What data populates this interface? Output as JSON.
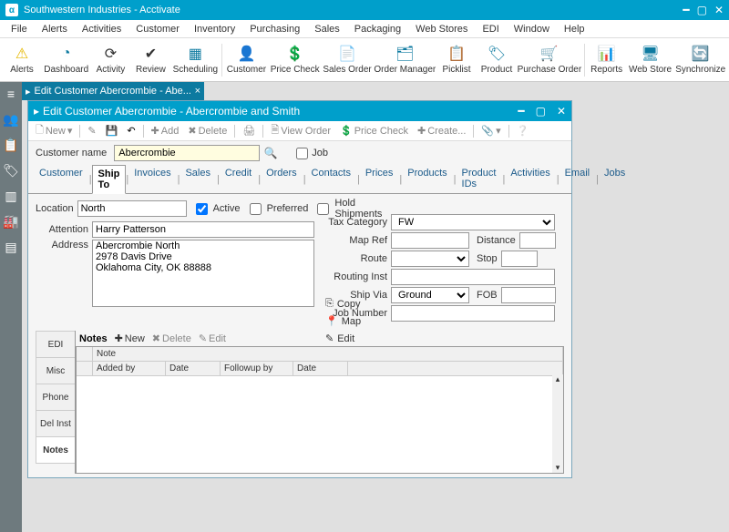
{
  "app": {
    "title": "Southwestern Industries - Acctivate"
  },
  "menu": [
    "File",
    "Alerts",
    "Activities",
    "Customer",
    "Inventory",
    "Purchasing",
    "Sales",
    "Packaging",
    "Web Stores",
    "EDI",
    "Window",
    "Help"
  ],
  "toolbar": [
    {
      "label": "Alerts",
      "icon": "⚠",
      "color": "#e6b800"
    },
    {
      "label": "Dashboard",
      "icon": "◔",
      "color": "#0d7aa0"
    },
    {
      "label": "Activity",
      "icon": "⟳",
      "color": "#333"
    },
    {
      "label": "Review",
      "icon": "✔",
      "color": "#333"
    },
    {
      "label": "Scheduling",
      "icon": "▦",
      "color": "#0d7aa0"
    },
    {
      "label": "Customer",
      "icon": "👤",
      "color": "#0d7aa0"
    },
    {
      "label": "Price Check",
      "icon": "💲",
      "color": "#2a9d3a"
    },
    {
      "label": "Sales Order",
      "icon": "📄",
      "color": "#0d7aa0"
    },
    {
      "label": "Order Manager",
      "icon": "🗂",
      "color": "#0d7aa0"
    },
    {
      "label": "Picklist",
      "icon": "📋",
      "color": "#0d7aa0"
    },
    {
      "label": "Product",
      "icon": "🏷",
      "color": "#0d7aa0"
    },
    {
      "label": "Purchase Order",
      "icon": "🛒",
      "color": "#0d7aa0"
    },
    {
      "label": "Reports",
      "icon": "📊",
      "color": "#0d7aa0"
    },
    {
      "label": "Web Store",
      "icon": "🖥",
      "color": "#0d7aa0"
    },
    {
      "label": "Synchronize",
      "icon": "🔄",
      "color": "#0d7aa0"
    }
  ],
  "toolbar_separators_after": [
    4,
    11
  ],
  "mdi_tab": {
    "title": "Edit Customer Abercrombie - Abe..."
  },
  "child": {
    "title": "Edit Customer Abercrombie - Abercrombie and Smith",
    "toolbar": {
      "new": "New",
      "add": "Add",
      "delete": "Delete",
      "view_order": "View Order",
      "price_check": "Price Check",
      "create": "Create..."
    },
    "customer_name_label": "Customer name",
    "customer_name": "Abercrombie",
    "job_label": "Job",
    "tabs": [
      "Customer",
      "Ship To",
      "Invoices",
      "Sales",
      "Credit",
      "Orders",
      "Contacts",
      "Prices",
      "Products",
      "Product IDs",
      "Activities",
      "Email",
      "Jobs"
    ],
    "active_tab_index": 1,
    "left": {
      "location_label": "Location",
      "location": "North",
      "active_label": "Active",
      "preferred_label": "Preferred",
      "hold_label": "Hold Shipments",
      "attention_label": "Attention",
      "attention": "Harry Patterson",
      "address_label": "Address",
      "address": "Abercrombie North\n2978 Davis Drive\nOklahoma City, OK 88888"
    },
    "actions": {
      "copy": "Copy",
      "map": "Map",
      "edit": "Edit"
    },
    "right": {
      "tax_cat_label": "Tax Category",
      "tax_cat": "FW",
      "map_ref_label": "Map Ref",
      "map_ref": "",
      "distance_label": "Distance",
      "distance": "",
      "route_label": "Route",
      "route": "",
      "stop_label": "Stop",
      "stop": "",
      "routing_label": "Routing Inst",
      "routing": "",
      "ship_via_label": "Ship Via",
      "ship_via": "Ground",
      "fob_label": "FOB",
      "fob": "",
      "job_num_label": "Job Number",
      "job_num": ""
    },
    "vtabs": [
      "EDI",
      "Misc",
      "Phone",
      "Del Inst",
      "Notes"
    ],
    "active_vtab_index": 4,
    "notes": {
      "label": "Notes",
      "new": "New",
      "delete": "Delete",
      "edit": "Edit",
      "cols": {
        "note": "Note",
        "added_by": "Added by",
        "date1": "Date",
        "followup_by": "Followup by",
        "date2": "Date"
      }
    }
  }
}
